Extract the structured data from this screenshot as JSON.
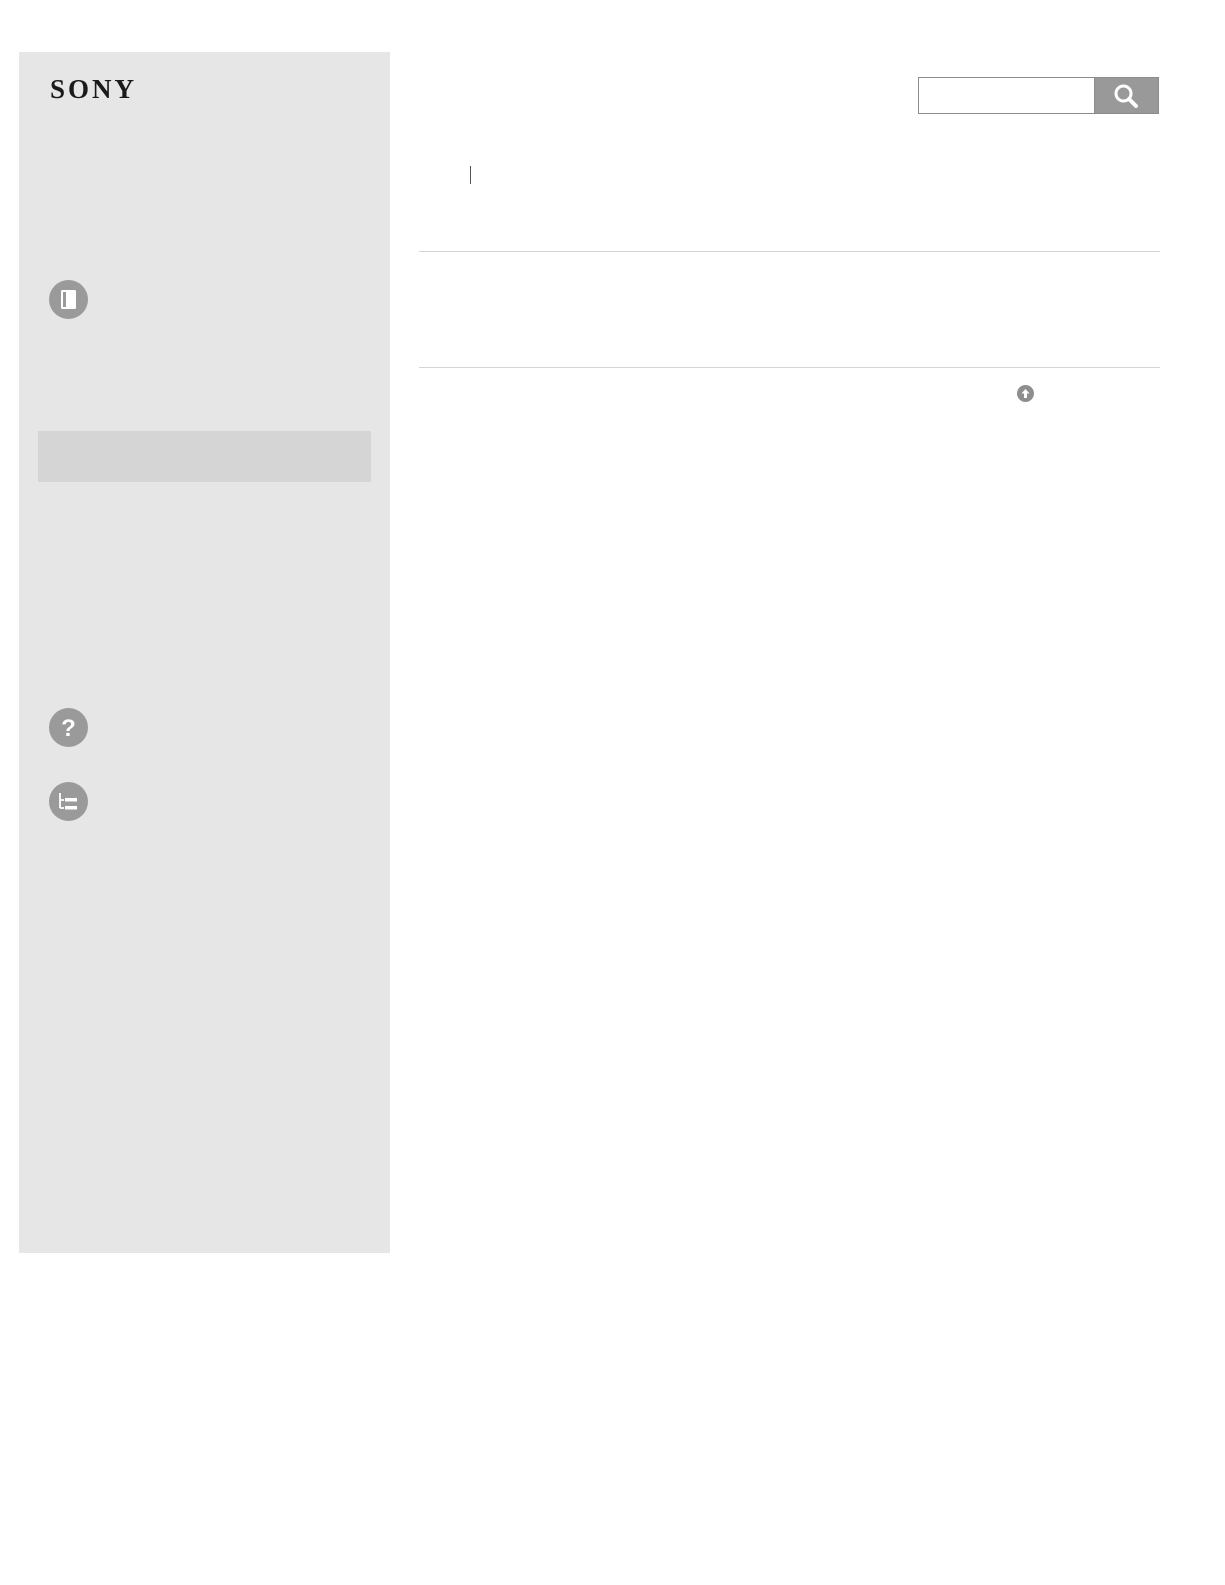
{
  "brand": {
    "logo_text": "SONY"
  },
  "search": {
    "placeholder": "",
    "value": ""
  },
  "colors": {
    "sidebar_bg": "#e6e6e6",
    "sidebar_highlight": "#d5d5d5",
    "icon_gray": "#9a9a9a",
    "search_button": "#999999"
  },
  "sidebar": {
    "icons": [
      {
        "name": "book-icon"
      },
      {
        "name": "help-question-icon"
      },
      {
        "name": "contents-tree-icon"
      }
    ]
  },
  "page_top": {
    "icon": "arrow-up-circle-icon"
  }
}
